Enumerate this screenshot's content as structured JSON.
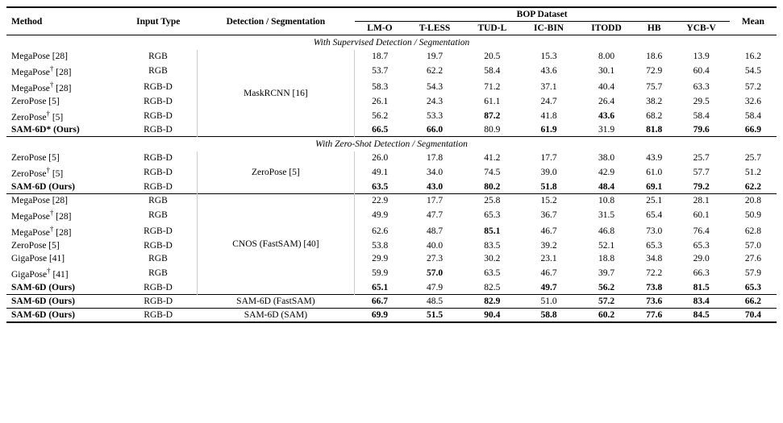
{
  "table": {
    "headers": {
      "method": "Method",
      "input_type": "Input Type",
      "detection": "Detection / Segmentation",
      "bop_dataset": "BOP Dataset",
      "datasets": [
        "LM-O",
        "T-LESS",
        "TUD-L",
        "IC-BIN",
        "ITODD",
        "HB",
        "YCB-V"
      ],
      "mean": "Mean"
    },
    "sections": [
      {
        "title": "With Supervised Detection / Segmentation",
        "detection_method": "MaskRCNN [16]",
        "rows": [
          {
            "method": "MegaPose [28]",
            "sup": "",
            "input": "RGB",
            "lmo": "18.7",
            "tless": "19.7",
            "tudl": "20.5",
            "icbin": "15.3",
            "itodd": "8.00",
            "hb": "18.6",
            "ycbv": "13.9",
            "mean": "16.2",
            "bold_cols": []
          },
          {
            "method": "MegaPose",
            "sup": "†",
            "ref": "[28]",
            "input": "RGB",
            "lmo": "53.7",
            "tless": "62.2",
            "tudl": "58.4",
            "icbin": "43.6",
            "itodd": "30.1",
            "hb": "72.9",
            "ycbv": "60.4",
            "mean": "54.5",
            "bold_cols": []
          },
          {
            "method": "MegaPose",
            "sup": "†",
            "ref": "[28]",
            "input": "RGB-D",
            "lmo": "58.3",
            "tless": "54.3",
            "tudl": "71.2",
            "icbin": "37.1",
            "itodd": "40.4",
            "hb": "75.7",
            "ycbv": "63.3",
            "mean": "57.2",
            "bold_cols": []
          },
          {
            "method": "ZeroPose [5]",
            "sup": "",
            "input": "RGB-D",
            "lmo": "26.1",
            "tless": "24.3",
            "tudl": "61.1",
            "icbin": "24.7",
            "itodd": "26.4",
            "hb": "38.2",
            "ycbv": "29.5",
            "mean": "32.6",
            "bold_cols": []
          },
          {
            "method": "ZeroPose",
            "sup": "†",
            "ref": "[5]",
            "input": "RGB-D",
            "lmo": "56.2",
            "tless": "53.3",
            "tudl": "87.2",
            "icbin": "41.8",
            "itodd": "43.6",
            "hb": "68.2",
            "ycbv": "58.4",
            "mean": "58.4",
            "bold_cols": [
              "tudl",
              "itodd"
            ]
          },
          {
            "method": "SAM-6D* (Ours)",
            "sup": "",
            "input": "RGB-D",
            "lmo": "66.5",
            "tless": "66.0",
            "tudl": "80.9",
            "icbin": "61.9",
            "itodd": "31.9",
            "hb": "81.8",
            "ycbv": "79.6",
            "mean": "66.9",
            "bold_cols": [
              "lmo",
              "tless",
              "icbin",
              "hb",
              "ycbv",
              "mean"
            ]
          }
        ]
      },
      {
        "title": "With Zero-Shot Detection / Segmentation",
        "detection_method": "ZeroPose [5]",
        "rows": [
          {
            "method": "ZeroPose [5]",
            "sup": "",
            "input": "RGB-D",
            "lmo": "26.0",
            "tless": "17.8",
            "tudl": "41.2",
            "icbin": "17.7",
            "itodd": "38.0",
            "hb": "43.9",
            "ycbv": "25.7",
            "mean": "25.7",
            "bold_cols": []
          },
          {
            "method": "ZeroPose",
            "sup": "†",
            "ref": "[5]",
            "input": "RGB-D",
            "lmo": "49.1",
            "tless": "34.0",
            "tudl": "74.5",
            "icbin": "39.0",
            "itodd": "42.9",
            "hb": "61.0",
            "ycbv": "57.7",
            "mean": "51.2",
            "bold_cols": []
          },
          {
            "method": "SAM-6D (Ours)",
            "sup": "",
            "input": "RGB-D",
            "lmo": "63.5",
            "tless": "43.0",
            "tudl": "80.2",
            "icbin": "51.8",
            "itodd": "48.4",
            "hb": "69.1",
            "ycbv": "79.2",
            "mean": "62.2",
            "bold_cols": [
              "lmo",
              "tless",
              "tudl",
              "icbin",
              "itodd",
              "hb",
              "ycbv",
              "mean"
            ]
          }
        ]
      },
      {
        "title": null,
        "detection_method": "CNOS (FastSAM) [40]",
        "rows": [
          {
            "method": "MegaPose [28]",
            "sup": "",
            "input": "RGB",
            "lmo": "22.9",
            "tless": "17.7",
            "tudl": "25.8",
            "icbin": "15.2",
            "itodd": "10.8",
            "hb": "25.1",
            "ycbv": "28.1",
            "mean": "20.8",
            "bold_cols": []
          },
          {
            "method": "MegaPose",
            "sup": "†",
            "ref": "[28]",
            "input": "RGB",
            "lmo": "49.9",
            "tless": "47.7",
            "tudl": "65.3",
            "icbin": "36.7",
            "itodd": "31.5",
            "hb": "65.4",
            "ycbv": "60.1",
            "mean": "50.9",
            "bold_cols": []
          },
          {
            "method": "MegaPose",
            "sup": "†",
            "ref": "[28]",
            "input": "RGB-D",
            "lmo": "62.6",
            "tless": "48.7",
            "tudl": "85.1",
            "icbin": "46.7",
            "itodd": "46.8",
            "hb": "73.0",
            "ycbv": "76.4",
            "mean": "62.8",
            "bold_cols": [
              "tudl"
            ]
          },
          {
            "method": "ZeroPose [5]",
            "sup": "",
            "input": "RGB-D",
            "lmo": "53.8",
            "tless": "40.0",
            "tudl": "83.5",
            "icbin": "39.2",
            "itodd": "52.1",
            "hb": "65.3",
            "ycbv": "65.3",
            "mean": "57.0",
            "bold_cols": []
          },
          {
            "method": "GigaPose [41]",
            "sup": "",
            "input": "RGB",
            "lmo": "29.9",
            "tless": "27.3",
            "tudl": "30.2",
            "icbin": "23.1",
            "itodd": "18.8",
            "hb": "34.8",
            "ycbv": "29.0",
            "mean": "27.6",
            "bold_cols": []
          },
          {
            "method": "GigaPose",
            "sup": "†",
            "ref": "[41]",
            "input": "RGB",
            "lmo": "59.9",
            "tless": "57.0",
            "tudl": "63.5",
            "icbin": "46.7",
            "itodd": "39.7",
            "hb": "72.2",
            "ycbv": "66.3",
            "mean": "57.9",
            "bold_cols": [
              "tless"
            ]
          },
          {
            "method": "SAM-6D (Ours)",
            "sup": "",
            "input": "RGB-D",
            "lmo": "65.1",
            "tless": "47.9",
            "tudl": "82.5",
            "icbin": "49.7",
            "itodd": "56.2",
            "hb": "73.8",
            "ycbv": "81.5",
            "mean": "65.3",
            "bold_cols": [
              "lmo",
              "icbin",
              "itodd",
              "hb",
              "ycbv",
              "mean"
            ]
          }
        ]
      }
    ],
    "standalone_rows": [
      {
        "method": "SAM-6D (Ours)",
        "input": "RGB-D",
        "detection": "SAM-6D (FastSAM)",
        "lmo": "66.7",
        "tless": "48.5",
        "tudl": "82.9",
        "icbin": "51.0",
        "itodd": "57.2",
        "hb": "73.6",
        "ycbv": "83.4",
        "mean": "66.2",
        "bold_cols": [
          "lmo",
          "tudl",
          "itodd",
          "hb",
          "ycbv",
          "mean"
        ]
      },
      {
        "method": "SAM-6D (Ours)",
        "input": "RGB-D",
        "detection": "SAM-6D (SAM)",
        "lmo": "69.9",
        "tless": "51.5",
        "tudl": "90.4",
        "icbin": "58.8",
        "itodd": "60.2",
        "hb": "77.6",
        "ycbv": "84.5",
        "mean": "70.4",
        "bold_cols": [
          "lmo",
          "tless",
          "tudl",
          "icbin",
          "itodd",
          "hb",
          "ycbv",
          "mean"
        ]
      }
    ]
  }
}
